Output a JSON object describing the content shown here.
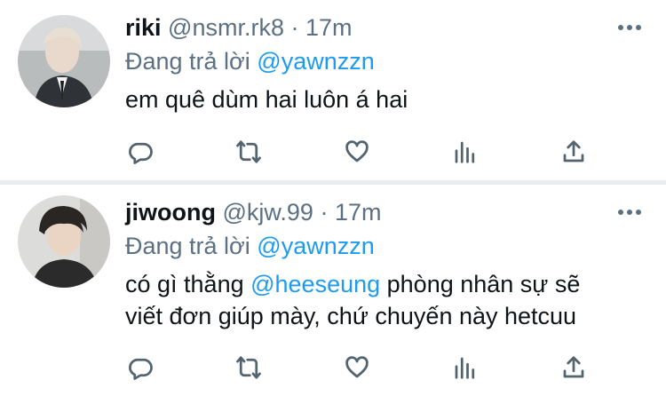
{
  "colors": {
    "accent": "#1d9bf0",
    "secondary_text": "#5b7083",
    "divider": "#e6ecf0"
  },
  "tweets": [
    {
      "name": "riki",
      "handle": "@nsmr.rk8",
      "separator": "·",
      "time": "17m",
      "reply_prefix": "Đang trả lời",
      "reply_to": "@yawnzzn",
      "text_parts": [
        "em quê dùm hai luôn á hai"
      ],
      "icons": [
        "reply-icon",
        "retweet-icon",
        "like-icon",
        "analytics-icon",
        "share-icon",
        "more-icon"
      ]
    },
    {
      "name": "jiwoong",
      "handle": "@kjw.99",
      "separator": "·",
      "time": "17m",
      "reply_prefix": "Đang trả lời",
      "reply_to": "@yawnzzn",
      "text_line1_before": "có gì thằng ",
      "text_line1_mention": "@heeseung",
      "text_line1_after": " phòng nhân sự sẽ",
      "text_line2": "viết đơn giúp mày, chứ chuyến này hetcuu",
      "icons": [
        "reply-icon",
        "retweet-icon",
        "like-icon",
        "analytics-icon",
        "share-icon",
        "more-icon"
      ]
    }
  ]
}
